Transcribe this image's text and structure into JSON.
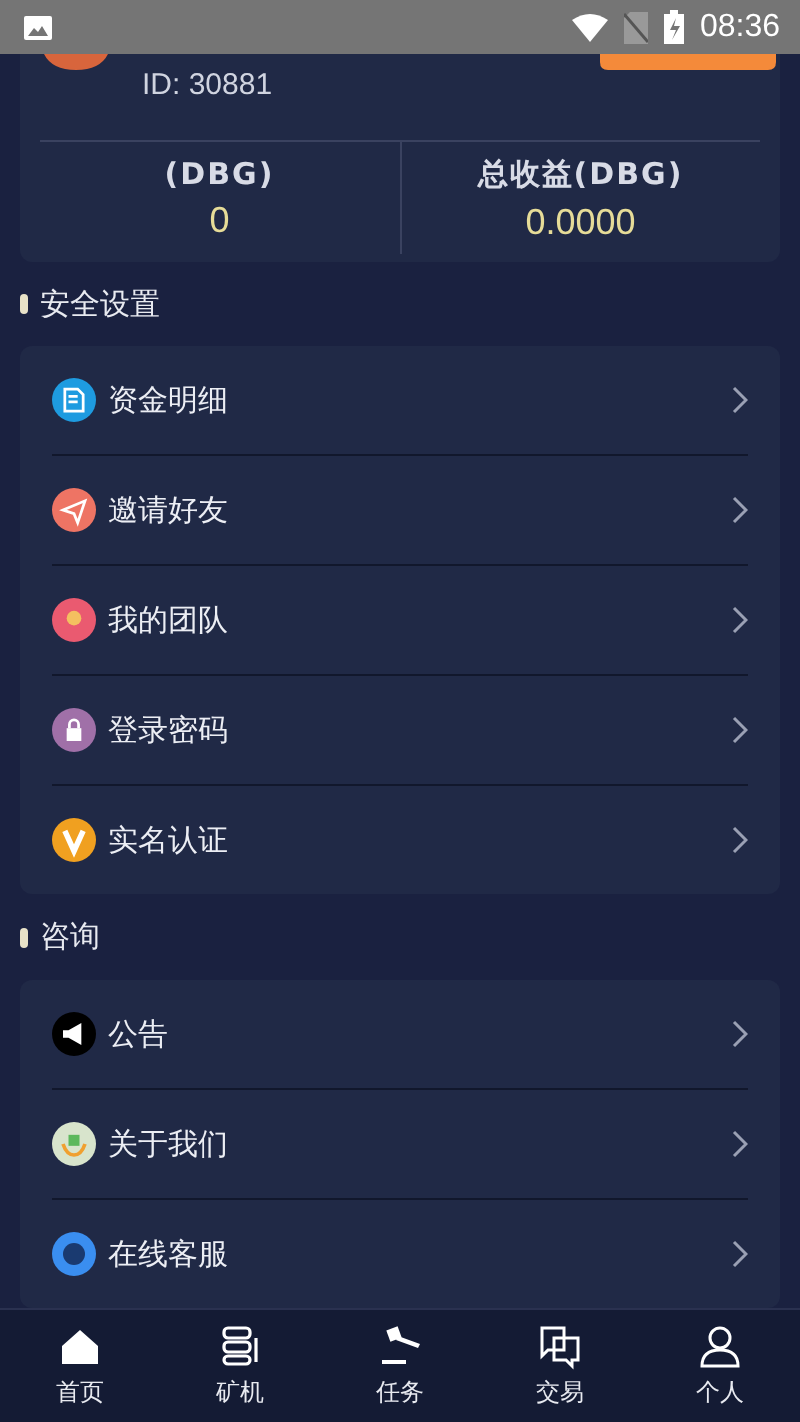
{
  "status_bar": {
    "time": "08:36"
  },
  "profile": {
    "id": "ID: 30881",
    "stats": [
      {
        "label": "(DBG)",
        "value": "0"
      },
      {
        "label": "总收益(DBG)",
        "value": "0.0000"
      }
    ]
  },
  "sections": [
    {
      "title": "安全设置",
      "items": [
        {
          "label": "资金明细"
        },
        {
          "label": "邀请好友"
        },
        {
          "label": "我的团队"
        },
        {
          "label": "登录密码"
        },
        {
          "label": "实名认证"
        }
      ]
    },
    {
      "title": "咨询",
      "items": [
        {
          "label": "公告"
        },
        {
          "label": "关于我们"
        },
        {
          "label": "在线客服"
        }
      ]
    }
  ],
  "nav": [
    {
      "label": "首页"
    },
    {
      "label": "矿机"
    },
    {
      "label": "任务"
    },
    {
      "label": "交易"
    },
    {
      "label": "个人"
    }
  ]
}
